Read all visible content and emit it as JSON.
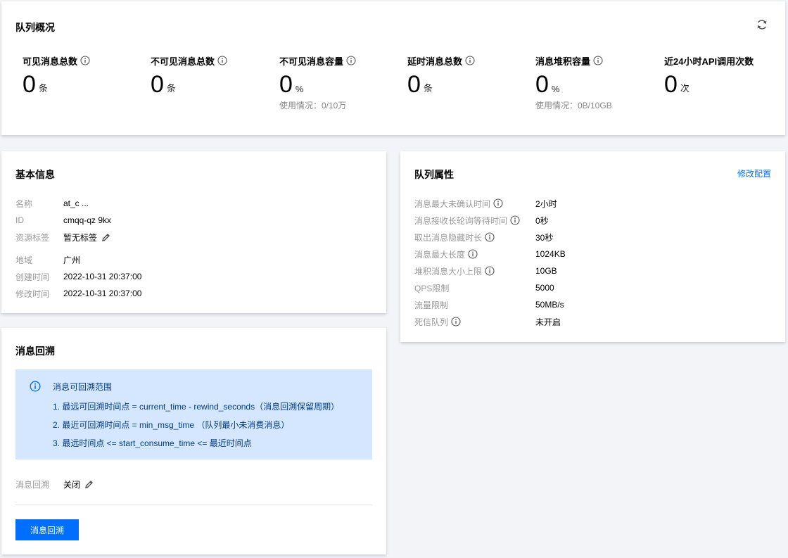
{
  "overview": {
    "title": "队列概况",
    "stats": [
      {
        "label": "可见消息总数",
        "value": "0",
        "unit": "条",
        "usage": "",
        "has_info": true
      },
      {
        "label": "不可见消息总数",
        "value": "0",
        "unit": "条",
        "usage": "",
        "has_info": true
      },
      {
        "label": "不可见消息容量",
        "value": "0",
        "unit": "%",
        "usage": "使用情况：0/10万",
        "has_info": true
      },
      {
        "label": "延时消息总数",
        "value": "0",
        "unit": "条",
        "usage": "",
        "has_info": true
      },
      {
        "label": "消息堆积容量",
        "value": "0",
        "unit": "%",
        "usage": "使用情况：0B/10GB",
        "has_info": true
      },
      {
        "label": "近24小时API调用次数",
        "value": "0",
        "unit": "次",
        "usage": "",
        "has_info": false
      }
    ]
  },
  "basic": {
    "title": "基本信息",
    "rows": [
      {
        "key": "名称",
        "value": "at_c      ...",
        "editable": false
      },
      {
        "key": "ID",
        "value": "cmqq-qz      9kx",
        "editable": false
      },
      {
        "key": "资源标签",
        "value": "暂无标签",
        "editable": true
      },
      {
        "key": "地域",
        "value": "广州",
        "editable": false
      },
      {
        "key": "创建时间",
        "value": "2022-10-31 20:37:00",
        "editable": false
      },
      {
        "key": "修改时间",
        "value": "2022-10-31 20:37:00",
        "editable": false
      }
    ]
  },
  "attrs": {
    "title": "队列属性",
    "edit_label": "修改配置",
    "rows": [
      {
        "key": "消息最大未确认时间",
        "value": "2小时",
        "has_info": true
      },
      {
        "key": "消息接收长轮询等待时间",
        "value": "0秒",
        "has_info": true
      },
      {
        "key": "取出消息隐藏时长",
        "value": "30秒",
        "has_info": true
      },
      {
        "key": "消息最大长度",
        "value": "1024KB",
        "has_info": true
      },
      {
        "key": "堆积消息大小上限",
        "value": "10GB",
        "has_info": true
      },
      {
        "key": "QPS限制",
        "value": "5000",
        "has_info": false
      },
      {
        "key": "流量限制",
        "value": "50MB/s",
        "has_info": false
      },
      {
        "key": "死信队列",
        "value": "未开启",
        "has_info": true
      }
    ]
  },
  "rewind": {
    "title": "消息回溯",
    "notice_title": "消息可回溯范围",
    "notice_lines": [
      "1. 最远可回溯时间点 = current_time - rewind_seconds（消息回溯保留周期）",
      "2. 最近可回溯时间点 = min_msg_time （队列最小未消费消息）",
      "3. 最远时间点 <= start_consume_time <= 最近时间点"
    ],
    "status_key": "消息回溯",
    "status_value": "关闭",
    "button_label": "消息回溯"
  },
  "colors": {
    "accent": "#006eff",
    "notice_bg": "#d5e7ff",
    "notice_text": "#003b80",
    "label_gray": "#999999"
  },
  "icons": [
    "refresh-icon",
    "info-icon",
    "pencil-icon"
  ]
}
